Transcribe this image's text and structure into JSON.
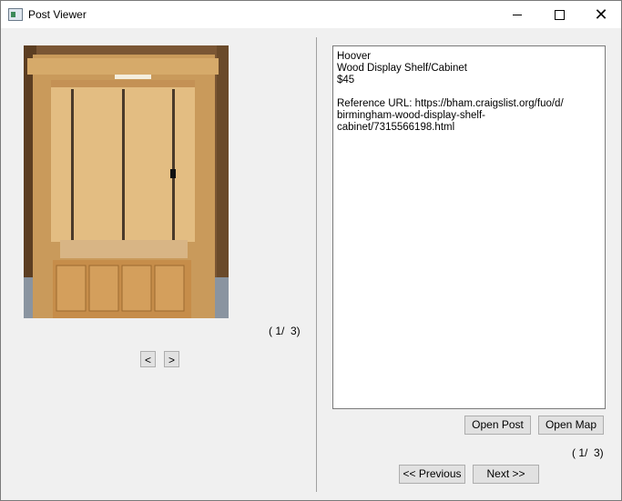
{
  "window": {
    "title": "Post Viewer",
    "controls": {
      "minimize": "minimize",
      "maximize": "maximize",
      "close": "✕"
    }
  },
  "image_panel": {
    "counter": "( 1/  3)",
    "prev_label": "<",
    "next_label": ">"
  },
  "post": {
    "location": "Hoover",
    "title": "Wood Display Shelf/Cabinet",
    "price": "$45",
    "reference_line1": "Reference URL: https://bham.craigslist.org/fuo/d/",
    "reference_line2": "birmingham-wood-display-shelf-cabinet/7315566198.html"
  },
  "actions": {
    "open_post": "Open Post",
    "open_map": "Open Map",
    "previous": "<< Previous",
    "next": "Next >>",
    "counter": "( 1/  3)"
  }
}
